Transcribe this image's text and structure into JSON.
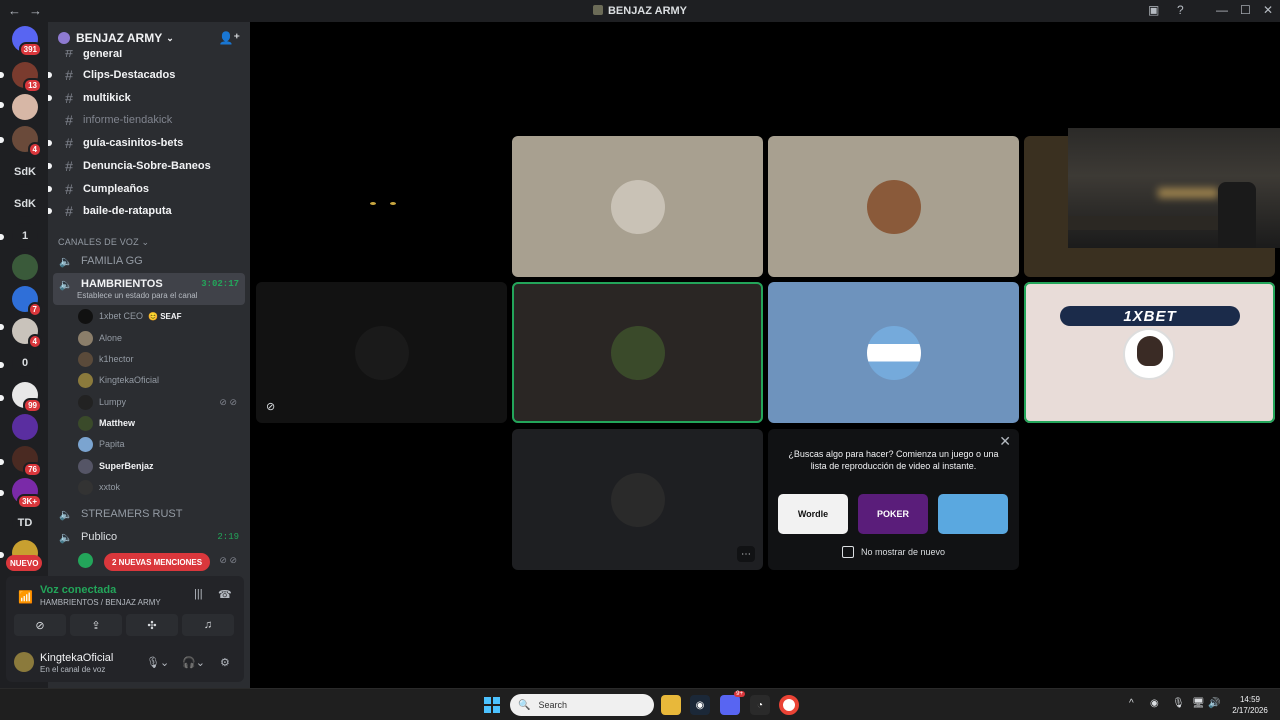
{
  "window": {
    "title": "BENJAZ ARMY"
  },
  "guilds": [
    {
      "label": "",
      "badge": "391",
      "color": "#5865f2"
    },
    {
      "label": "",
      "badge": "13",
      "color": "#7a3b2e"
    },
    {
      "label": "",
      "badge": "",
      "color": "#d7b7a6"
    },
    {
      "label": "",
      "badge": "4",
      "color": "#6a4a3a"
    },
    {
      "label": "SdK",
      "badge": "",
      "color": "#1e1f22"
    },
    {
      "label": "SdK",
      "badge": "",
      "color": "#1e1f22"
    },
    {
      "label": "1",
      "badge": "",
      "color": "#1e1f22"
    },
    {
      "label": "",
      "badge": "",
      "color": "#3a5a3a"
    },
    {
      "label": "",
      "badge": "7",
      "color": "#2f6fd8"
    },
    {
      "label": "",
      "badge": "4",
      "color": "#c9c3bb"
    },
    {
      "label": "0",
      "badge": "",
      "color": "#1e1f22"
    },
    {
      "label": "",
      "badge": "99",
      "color": "#e8e8e8"
    },
    {
      "label": "",
      "badge": "",
      "color": "#5a2ea0"
    },
    {
      "label": "",
      "badge": "76",
      "color": "#4a2a22"
    },
    {
      "label": "",
      "badge": "3K+",
      "color": "#7a2aa8"
    },
    {
      "label": "TD",
      "badge": "",
      "color": "#1e1f22"
    },
    {
      "label": "",
      "badge": "",
      "color": "#c8a030"
    }
  ],
  "server": {
    "name": "BENJAZ ARMY"
  },
  "text_channels": [
    {
      "name": "general",
      "muted": false
    },
    {
      "name": "Clips-Destacados",
      "muted": false
    },
    {
      "name": "multikick",
      "muted": false
    },
    {
      "name": "informe-tiendakick",
      "muted": true
    },
    {
      "name": "guía-casinitos-bets",
      "muted": false
    },
    {
      "name": "Denuncia-Sobre-Baneos",
      "muted": false
    },
    {
      "name": "Cumpleaños",
      "muted": false
    },
    {
      "name": "baile-de-rataputa",
      "muted": false
    }
  ],
  "voice_category": "CANALES DE VOZ",
  "voice_channels": {
    "familia": "FAMILIA GG",
    "active": {
      "name": "HAMBRIENTOS",
      "timer": "3:02:17",
      "status": "Establece un estado para el canal"
    },
    "streamers": "STREAMERS RUST",
    "publico": {
      "name": "Publico",
      "timer": "2:19"
    }
  },
  "voice_users": [
    {
      "name": "1xbet CEO",
      "tag": "😊 SEAF",
      "bold": false,
      "color": "#111"
    },
    {
      "name": "Alone",
      "tag": "",
      "bold": false,
      "color": "#8b7e6a"
    },
    {
      "name": "k1hector",
      "tag": "",
      "bold": false,
      "color": "#5a4a3a"
    },
    {
      "name": "KingtekaOficial",
      "tag": "",
      "bold": false,
      "color": "#8b7a3c"
    },
    {
      "name": "Lumpy",
      "tag": "",
      "bold": false,
      "color": "#222"
    },
    {
      "name": "Matthew",
      "tag": "",
      "bold": true,
      "color": "#3a4a2a"
    },
    {
      "name": "Papita",
      "tag": "",
      "bold": false,
      "color": "#7ba4d0"
    },
    {
      "name": "SuperBenjaz",
      "tag": "",
      "bold": true,
      "color": "#556"
    },
    {
      "name": "xxtok",
      "tag": "",
      "bold": false,
      "color": "#333"
    }
  ],
  "mentions_label": "2 NUEVAS MENCIONES",
  "nuevo_label": "NUEVO",
  "voice_panel": {
    "status": "Voz conectada",
    "channel": "HAMBRIENTOS / BENJAZ ARMY"
  },
  "me": {
    "name": "KingtekaOficial",
    "status": "En el canal de voz"
  },
  "activity": {
    "message": "¿Buscas algo para hacer? Comienza un juego o una lista de reproducción de video al instante.",
    "games": [
      "Wordle",
      "POKER",
      ""
    ],
    "checkbox_label": "No mostrar de nuevo"
  },
  "stream_banner": "1XBET",
  "taskbar": {
    "search_placeholder": "Search",
    "time": "14:59",
    "date": "2/17/2026",
    "discord_badge": "9+"
  }
}
